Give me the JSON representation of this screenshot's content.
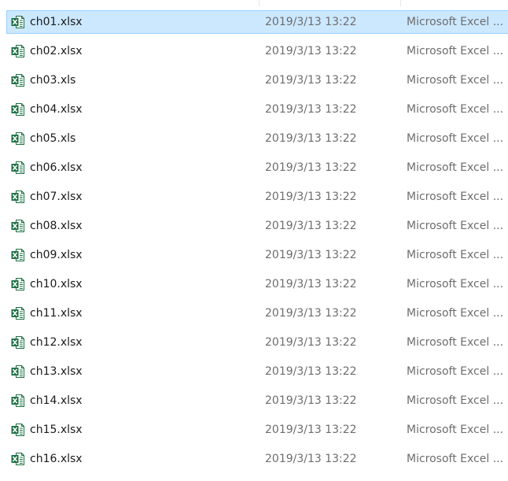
{
  "files": [
    {
      "name": "ch01.xlsx",
      "modified": "2019/3/13 13:22",
      "type": "Microsoft Excel ...",
      "icon": "excel-xlsx-icon",
      "selected": true
    },
    {
      "name": "ch02.xlsx",
      "modified": "2019/3/13 13:22",
      "type": "Microsoft Excel ...",
      "icon": "excel-xlsx-icon",
      "selected": false
    },
    {
      "name": "ch03.xls",
      "modified": "2019/3/13 13:22",
      "type": "Microsoft Excel ...",
      "icon": "excel-xls-icon",
      "selected": false
    },
    {
      "name": "ch04.xlsx",
      "modified": "2019/3/13 13:22",
      "type": "Microsoft Excel ...",
      "icon": "excel-xlsx-icon",
      "selected": false
    },
    {
      "name": "ch05.xls",
      "modified": "2019/3/13 13:22",
      "type": "Microsoft Excel ...",
      "icon": "excel-xls-icon",
      "selected": false
    },
    {
      "name": "ch06.xlsx",
      "modified": "2019/3/13 13:22",
      "type": "Microsoft Excel ...",
      "icon": "excel-xlsx-icon",
      "selected": false
    },
    {
      "name": "ch07.xlsx",
      "modified": "2019/3/13 13:22",
      "type": "Microsoft Excel ...",
      "icon": "excel-xlsx-icon",
      "selected": false
    },
    {
      "name": "ch08.xlsx",
      "modified": "2019/3/13 13:22",
      "type": "Microsoft Excel ...",
      "icon": "excel-xlsx-icon",
      "selected": false
    },
    {
      "name": "ch09.xlsx",
      "modified": "2019/3/13 13:22",
      "type": "Microsoft Excel ...",
      "icon": "excel-xlsx-icon",
      "selected": false
    },
    {
      "name": "ch10.xlsx",
      "modified": "2019/3/13 13:22",
      "type": "Microsoft Excel ...",
      "icon": "excel-xlsx-icon",
      "selected": false
    },
    {
      "name": "ch11.xlsx",
      "modified": "2019/3/13 13:22",
      "type": "Microsoft Excel ...",
      "icon": "excel-xlsx-icon",
      "selected": false
    },
    {
      "name": "ch12.xlsx",
      "modified": "2019/3/13 13:22",
      "type": "Microsoft Excel ...",
      "icon": "excel-xlsx-icon",
      "selected": false
    },
    {
      "name": "ch13.xlsx",
      "modified": "2019/3/13 13:22",
      "type": "Microsoft Excel ...",
      "icon": "excel-xlsx-icon",
      "selected": false
    },
    {
      "name": "ch14.xlsx",
      "modified": "2019/3/13 13:22",
      "type": "Microsoft Excel ...",
      "icon": "excel-xlsx-icon",
      "selected": false
    },
    {
      "name": "ch15.xlsx",
      "modified": "2019/3/13 13:22",
      "type": "Microsoft Excel ...",
      "icon": "excel-xlsx-icon",
      "selected": false
    },
    {
      "name": "ch16.xlsx",
      "modified": "2019/3/13 13:22",
      "type": "Microsoft Excel ...",
      "icon": "excel-xlsx-icon",
      "selected": false
    }
  ],
  "colors": {
    "selected_background": "#cce8ff",
    "selected_border": "#99d1ff",
    "excel_green": "#1d7044",
    "name_text": "#1a1a1a",
    "detail_text": "#6d6d6d"
  }
}
